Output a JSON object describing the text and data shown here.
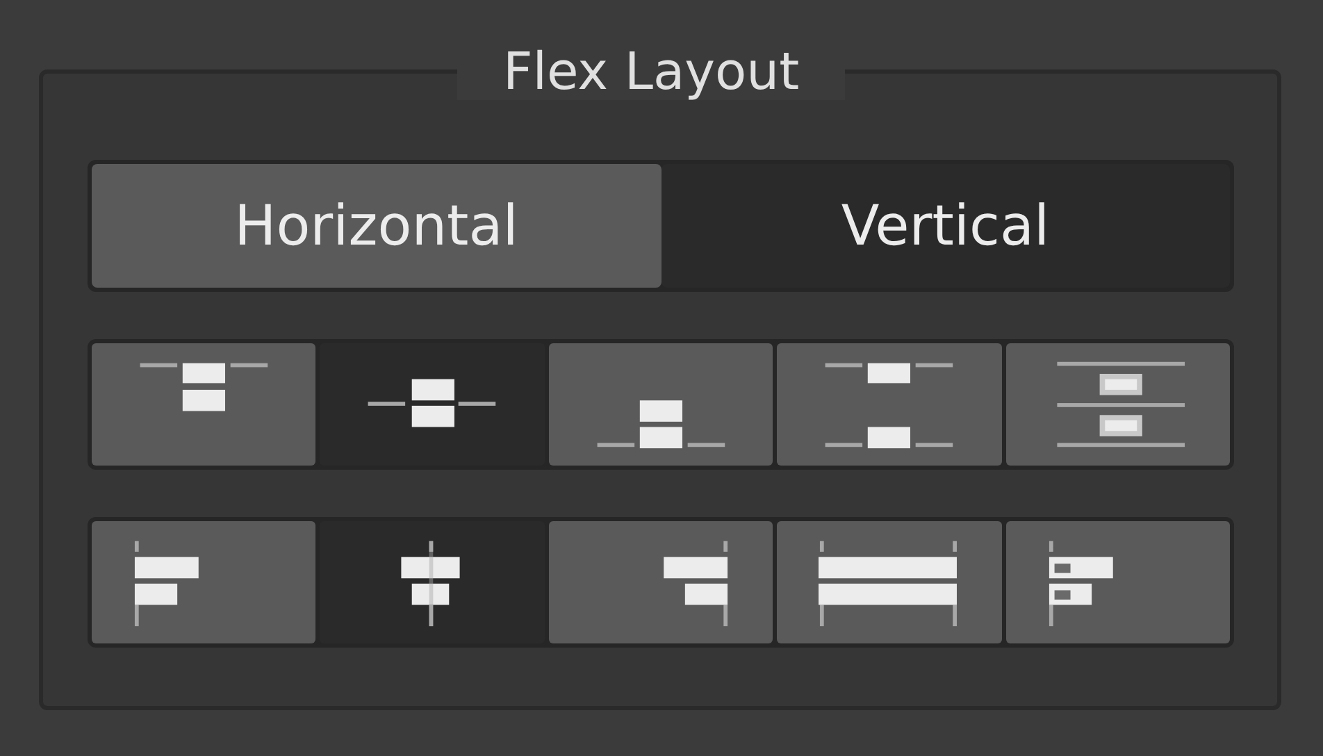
{
  "panel": {
    "title": "Flex Layout"
  },
  "direction_tabs": [
    {
      "label": "Horizontal",
      "selected": false
    },
    {
      "label": "Vertical",
      "selected": true
    }
  ],
  "justify_options": [
    {
      "kind": "start",
      "selected": false
    },
    {
      "kind": "center",
      "selected": true
    },
    {
      "kind": "end",
      "selected": false
    },
    {
      "kind": "space-between",
      "selected": false
    },
    {
      "kind": "space-around",
      "selected": false
    }
  ],
  "align_options": [
    {
      "kind": "start",
      "selected": false
    },
    {
      "kind": "center",
      "selected": true
    },
    {
      "kind": "end",
      "selected": false
    },
    {
      "kind": "stretch",
      "selected": false
    },
    {
      "kind": "baseline",
      "selected": false
    }
  ]
}
